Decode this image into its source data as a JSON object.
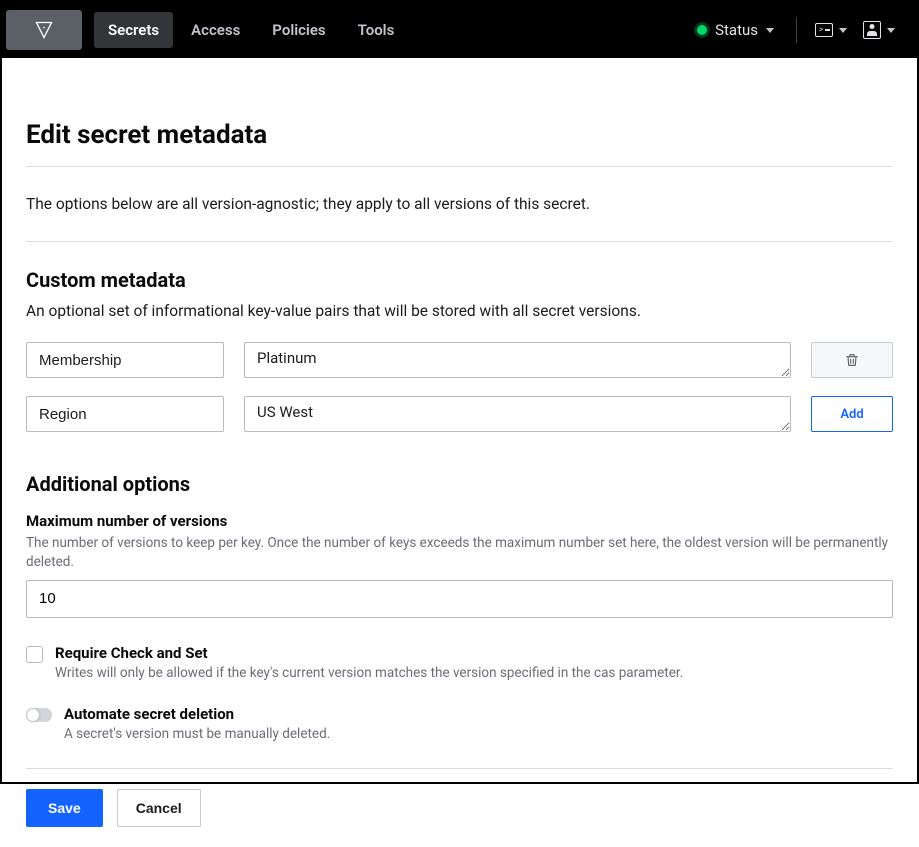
{
  "nav": {
    "items": [
      "Secrets",
      "Access",
      "Policies",
      "Tools"
    ],
    "active_index": 0,
    "status_label": "Status"
  },
  "page": {
    "title": "Edit secret metadata",
    "intro": "The options below are all version-agnostic; they apply to all versions of this secret."
  },
  "custom_metadata": {
    "heading": "Custom metadata",
    "description": "An optional set of informational key-value pairs that will be stored with all secret versions.",
    "rows": [
      {
        "key": "Membership",
        "value": "Platinum"
      },
      {
        "key": "Region",
        "value": "US West"
      }
    ],
    "add_label": "Add"
  },
  "additional": {
    "heading": "Additional options",
    "max_versions": {
      "label": "Maximum number of versions",
      "help": "The number of versions to keep per key. Once the number of keys exceeds the maximum number set here, the oldest version will be permanently deleted.",
      "value": "10"
    },
    "require_cas": {
      "label": "Require Check and Set",
      "help": "Writes will only be allowed if the key's current version matches the version specified in the cas parameter."
    },
    "automate_delete": {
      "label": "Automate secret deletion",
      "help": "A secret's version must be manually deleted."
    }
  },
  "actions": {
    "save": "Save",
    "cancel": "Cancel"
  }
}
